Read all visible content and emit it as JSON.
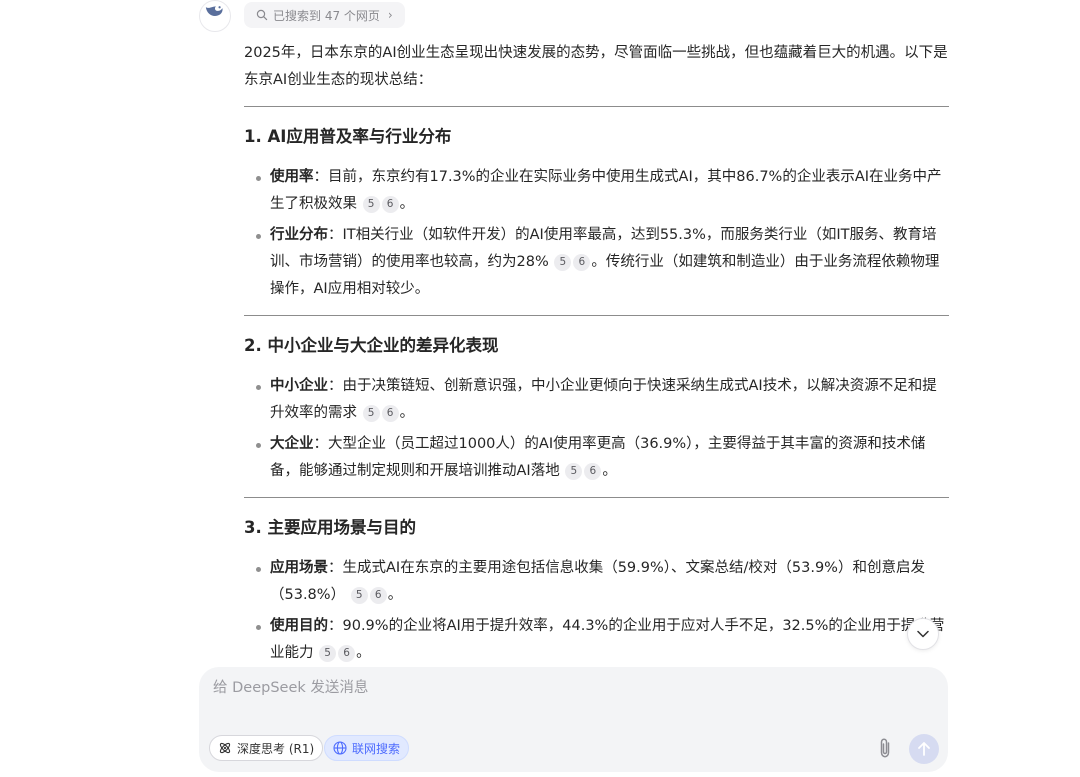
{
  "search_pill": {
    "label": "已搜索到 47 个网页",
    "chevron": "›"
  },
  "intro": "2025年，日本东京的AI创业生态呈现出快速发展的态势，尽管面临一些挑战，但也蕴藏着巨大的机遇。以下是东京AI创业生态的现状总结：",
  "sections": [
    {
      "heading": "1. AI应用普及率与行业分布",
      "items": [
        {
          "term": "使用率",
          "text": "：目前，东京约有17.3%的企业在实际业务中使用生成式AI，其中86.7%的企业表示AI在业务中产生了积极效果",
          "cites": [
            "5",
            "6"
          ],
          "after": "。"
        },
        {
          "term": "行业分布",
          "text": "：IT相关行业（如软件开发）的AI使用率最高，达到55.3%，而服务类行业（如IT服务、教育培训、市场营销）的使用率也较高，约为28%",
          "cites": [
            "5",
            "6"
          ],
          "after": "。传统行业（如建筑和制造业）由于业务流程依赖物理操作，AI应用相对较少。"
        }
      ]
    },
    {
      "heading": "2. 中小企业与大企业的差异化表现",
      "items": [
        {
          "term": "中小企业",
          "text": "：由于决策链短、创新意识强，中小企业更倾向于快速采纳生成式AI技术，以解决资源不足和提升效率的需求",
          "cites": [
            "5",
            "6"
          ],
          "after": "。"
        },
        {
          "term": "大企业",
          "text": "：大型企业（员工超过1000人）的AI使用率更高（36.9%），主要得益于其丰富的资源和技术储备，能够通过制定规则和开展培训推动AI落地",
          "cites": [
            "5",
            "6"
          ],
          "after": "。"
        }
      ]
    },
    {
      "heading": "3. 主要应用场景与目的",
      "items": [
        {
          "term": "应用场景",
          "text": "：生成式AI在东京的主要用途包括信息收集（59.9%）、文案总结/校对（53.9%）和创意启发（53.8%）",
          "cites": [
            "5",
            "6"
          ],
          "after": "。"
        },
        {
          "term": "使用目的",
          "text": "：90.9%的企业将AI用于提升效率，44.3%的企业用于应对人手不足，32.5%的企业用于提升营业能力",
          "cites": [
            "5",
            "6"
          ],
          "after": "。"
        }
      ]
    }
  ],
  "composer": {
    "placeholder": "给 DeepSeek 发送消息",
    "deep_think_label": "深度思考 (R1)",
    "web_search_label": "联网搜索"
  },
  "colors": {
    "accent": "#4d6bfe",
    "send_disabled": "#d6dbf1",
    "composer_bg": "#f3f4f6"
  },
  "icons": [
    "deepseek-logo-icon",
    "search-icon",
    "atom-icon",
    "globe-icon",
    "paperclip-icon",
    "arrow-up-icon",
    "chevron-down-icon"
  ]
}
